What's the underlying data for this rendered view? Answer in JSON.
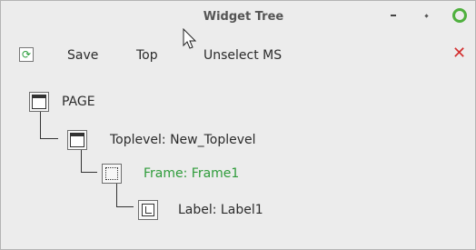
{
  "window": {
    "title": "Widget Tree"
  },
  "toolbar": {
    "refresh_icon": "refresh-icon",
    "save_label": "Save",
    "top_label": "Top",
    "unselect_label": "Unselect MS",
    "close_glyph": "✕"
  },
  "tree": {
    "nodes": [
      {
        "label": "PAGE",
        "icon": "window-icon"
      },
      {
        "label": "Toplevel: New_Toplevel",
        "icon": "toplevel-icon"
      },
      {
        "label": "Frame: Frame1",
        "icon": "frame-icon",
        "selected": true
      },
      {
        "label": "Label: Label1",
        "icon": "label-icon"
      }
    ]
  },
  "colors": {
    "selected_text": "#2e9b3a",
    "close_red": "#d32f2f",
    "maximize_ring": "#4fb03e"
  }
}
